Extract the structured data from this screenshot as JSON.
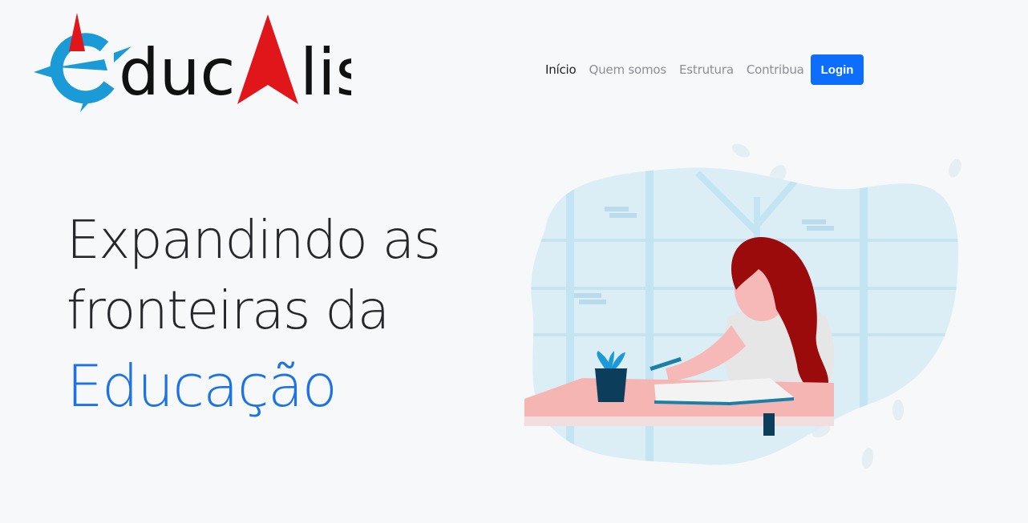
{
  "brand": {
    "logo_text": "educalis",
    "colors": {
      "blue": "#1a9ad6",
      "red": "#e0161b",
      "dark": "#111111"
    }
  },
  "nav": {
    "items": [
      {
        "label": "Início",
        "active": true
      },
      {
        "label": "Quem somos",
        "active": false
      },
      {
        "label": "Estrutura",
        "active": false
      },
      {
        "label": "Contribua",
        "active": false
      }
    ],
    "login_label": "Login"
  },
  "hero": {
    "line1": "Expandindo as",
    "line2": "fronteiras da",
    "accent": "Educação"
  },
  "illustration": {
    "subject": "woman-writing-at-desk",
    "colors": {
      "window_bg": "#dbeef6",
      "frame": "#c3e4f2",
      "hair": "#9b0b0b",
      "skin": "#f6b9b7",
      "desk": "#f5b5b3",
      "cup": "#0c3e5c",
      "book": "#1c7fa8"
    }
  }
}
